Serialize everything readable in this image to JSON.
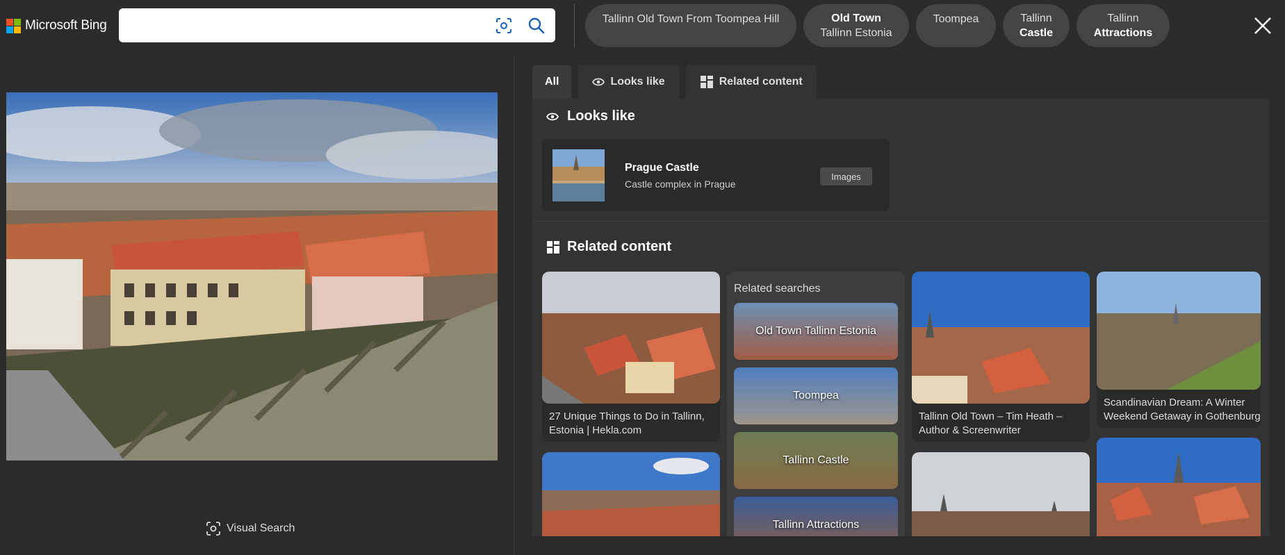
{
  "brand": {
    "name": "Microsoft Bing",
    "logo_colors": [
      "#f25022",
      "#7fba00",
      "#00a4ef",
      "#ffb900"
    ]
  },
  "search": {
    "value": "",
    "placeholder": "",
    "camera_icon": "visual-search-icon",
    "search_icon": "magnifier-icon"
  },
  "chips": [
    {
      "line1": "Tallinn Old Town From Toompea Hill",
      "line2": ""
    },
    {
      "line1": "Old Town",
      "line2": "Tallinn Estonia"
    },
    {
      "line1": "Toompea",
      "line2": ""
    },
    {
      "line1": "Tallinn",
      "line2": "Castle"
    },
    {
      "line1": "Tallinn",
      "line2": "Attractions"
    }
  ],
  "close_icon": "close-icon",
  "left": {
    "visual_search_label": "Visual Search"
  },
  "tabs": [
    {
      "label": "All",
      "icon": ""
    },
    {
      "label": "Looks like",
      "icon": "eye-icon"
    },
    {
      "label": "Related content",
      "icon": "grid-icon"
    }
  ],
  "looks_like": {
    "heading": "Looks like",
    "title": "Prague Castle",
    "subtitle": "Castle complex in Prague",
    "button": "Images"
  },
  "related": {
    "heading": "Related content",
    "cards": [
      {
        "caption": "27 Unique Things to Do in Tallinn, Estonia | Hekla.com"
      },
      {
        "caption": "Tallinn Old Town – Tim Heath – Author & Screenwriter"
      },
      {
        "caption": "Scandinavian Dream: A Winter Weekend Getaway in Gothenburg"
      }
    ],
    "searches_title": "Related searches",
    "searches": [
      "Old Town Tallinn Estonia",
      "Toompea",
      "Tallinn Castle",
      "Tallinn Attractions"
    ]
  },
  "colors": {
    "background": "#2b2b2b",
    "panel": "#333333",
    "chip": "#444444",
    "accent_roof": "#c8553a"
  }
}
